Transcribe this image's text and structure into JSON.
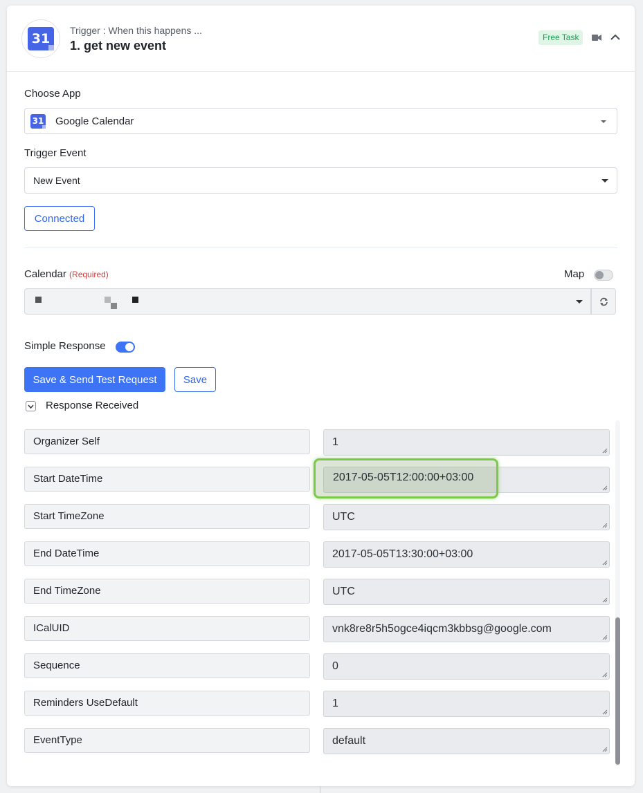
{
  "header": {
    "logo_text": "31",
    "trigger_label": "Trigger : When this happens ...",
    "step_title": "1. get new event",
    "badge": "Free Task",
    "video_icon": "video-camera-icon",
    "collapse_icon": "chevron-up-icon"
  },
  "form": {
    "choose_app_label": "Choose App",
    "app_value": "Google Calendar",
    "trigger_event_label": "Trigger Event",
    "trigger_event_value": "New Event",
    "connected_label": "Connected",
    "calendar_label": "Calendar",
    "required_label": "(Required)",
    "map_label": "Map",
    "simple_response_label": "Simple Response",
    "save_send_label": "Save & Send Test Request",
    "save_label": "Save",
    "response_received_label": "Response Received"
  },
  "response_rows": [
    {
      "key": "Organizer Self",
      "value": "1"
    },
    {
      "key": "Start DateTime",
      "value": "2017-05-05T12:00:00+03:00"
    },
    {
      "key": "Start TimeZone",
      "value": "UTC"
    },
    {
      "key": "End DateTime",
      "value": "2017-05-05T13:30:00+03:00"
    },
    {
      "key": "End TimeZone",
      "value": "UTC"
    },
    {
      "key": "ICalUID",
      "value": "vnk8re8r5h5ogce4iqcm3kbbsg@google.com"
    },
    {
      "key": "Sequence",
      "value": "0"
    },
    {
      "key": "Reminders UseDefault",
      "value": "1"
    },
    {
      "key": "EventType",
      "value": "default"
    }
  ],
  "colors": {
    "primary": "#3d74f6",
    "badge_bg": "#dff5e6",
    "badge_text": "#1f9d55",
    "required": "#d43a3a",
    "highlight": "#7cc94a"
  }
}
